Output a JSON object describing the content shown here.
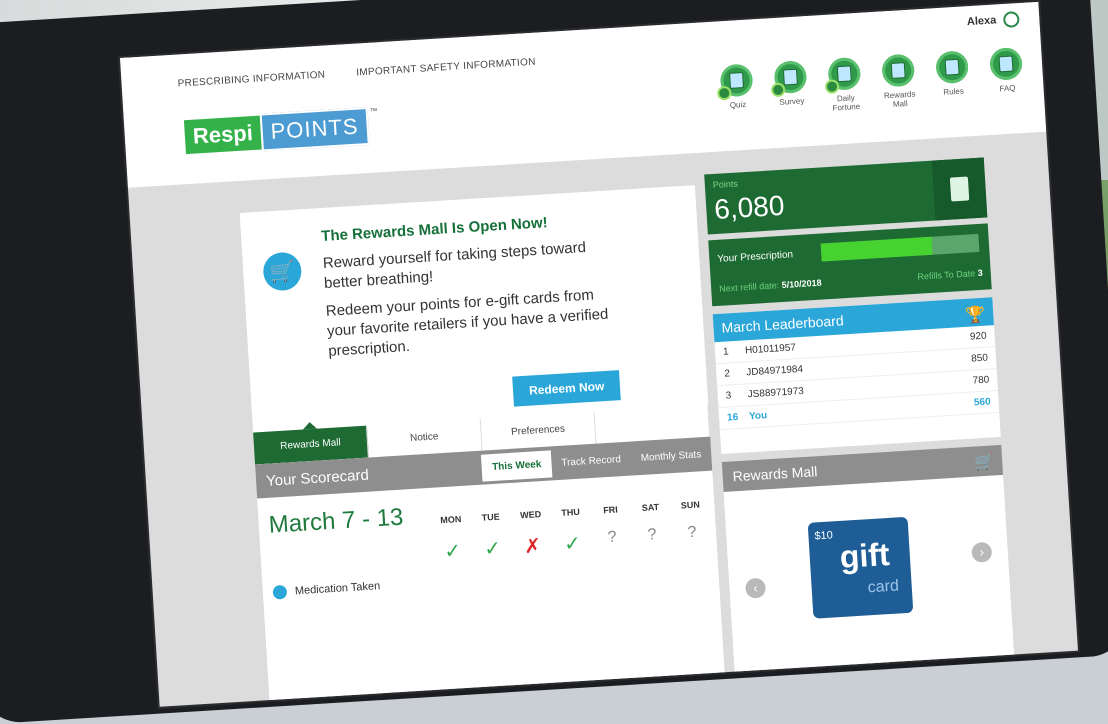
{
  "header": {
    "links": [
      "PRESCRIBING INFORMATION",
      "IMPORTANT SAFETY INFORMATION"
    ],
    "user": "Alexa",
    "logo": {
      "part1": "Respi",
      "part2": "POINTS",
      "tm": "™"
    }
  },
  "nav": [
    {
      "label": "Quiz",
      "icon": "quiz-icon",
      "badge": true
    },
    {
      "label": "Survey",
      "icon": "survey-icon",
      "badge": true
    },
    {
      "label": "Daily Fortune",
      "icon": "fortune-icon",
      "badge": true
    },
    {
      "label": "Rewards Mall",
      "icon": "cart-icon",
      "badge": false
    },
    {
      "label": "Rules",
      "icon": "rules-icon",
      "badge": false
    },
    {
      "label": "FAQ",
      "icon": "faq-icon",
      "badge": false
    }
  ],
  "notice": {
    "title": "The Rewards Mall Is Open Now!",
    "p1": "Reward yourself for taking steps toward better breathing!",
    "p2": "Redeem your points for e-gift cards from your favorite retailers if you have a verified prescription.",
    "button": "Redeem Now"
  },
  "tabs": [
    "Rewards Mall",
    "Notice",
    "Preferences",
    ""
  ],
  "scorecard": {
    "title": "Your Scorecard",
    "tabs": [
      "This Week",
      "Track Record",
      "Monthly Stats"
    ],
    "week": "March 7 - 13",
    "days": [
      "MON",
      "TUE",
      "WED",
      "THU",
      "FRI",
      "SAT",
      "SUN"
    ],
    "marks": [
      "✓",
      "✓",
      "✗",
      "✓",
      "?",
      "?",
      "?"
    ],
    "row_label": "Medication Taken"
  },
  "points": {
    "label": "Points",
    "value": "6,080"
  },
  "prescription": {
    "label": "Your Prescription",
    "next_label": "Next refill date:",
    "next_date": "5/10/2018",
    "refills_label": "Refills To Date",
    "refills": "3",
    "progress": 0.7
  },
  "leaderboard": {
    "title": "March Leaderboard",
    "rows": [
      {
        "rank": "1",
        "name": "H01011957",
        "pts": "920"
      },
      {
        "rank": "2",
        "name": "JD84971984",
        "pts": "850"
      },
      {
        "rank": "3",
        "name": "JS88971973",
        "pts": "780"
      },
      {
        "rank": "16",
        "name": "You",
        "pts": "560"
      }
    ]
  },
  "mall": {
    "title": "Rewards Mall",
    "card_amount": "$10",
    "card_word": "gift",
    "card_sub": "card"
  }
}
